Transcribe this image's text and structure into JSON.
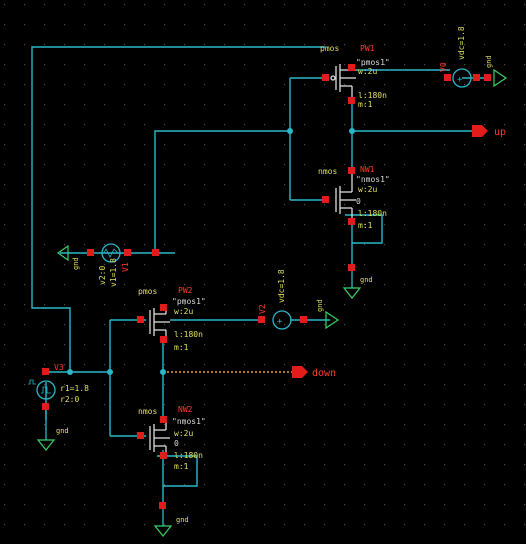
{
  "colors": {
    "background": "#000000",
    "grid": "#4a4a4a",
    "wire": "#2ab7c9",
    "device": "#dcdcdc",
    "pin": "#e21b1b",
    "label": "#ff3b30",
    "name": "#e0e05a",
    "ground": "#3cd06a",
    "net_selected": "#e8a34a"
  },
  "devices": {
    "pw1": {
      "model": "pmos",
      "name": "PW1",
      "cell": "\"pmos1\"",
      "w": "w:2u",
      "l": "l:180n",
      "m": "m:1"
    },
    "nw1": {
      "model": "nmos",
      "name": "NW1",
      "cell": "\"nmos1\"",
      "w": "w:2u",
      "l": "l:180n",
      "m": "m:1",
      "zero": "0"
    },
    "pw2": {
      "model": "pmos",
      "name": "PW2",
      "cell": "\"pmos1\"",
      "w": "w:2u",
      "l": "l:180n",
      "m": "m:1"
    },
    "nw2": {
      "model": "nmos",
      "name": "NW2",
      "cell": "\"nmos1\"",
      "w": "w:2u",
      "l": "l:180n",
      "m": "m:1",
      "zero": "0"
    }
  },
  "sources": {
    "v0": {
      "name": "V0",
      "value": "vdc=1.8",
      "pin": "V0"
    },
    "v1": {
      "name": "V1",
      "v1": "v1=1.8",
      "v2": "v2:0",
      "pin": "V1"
    },
    "v2": {
      "name": "V2",
      "value": "vdc=1.8",
      "pin": "V2"
    },
    "v3": {
      "name": "V3",
      "r1": "r1=1.8",
      "r2": "r2:0"
    }
  },
  "net_labels": {
    "gnd": "gnd",
    "up": "up",
    "down": "down"
  }
}
